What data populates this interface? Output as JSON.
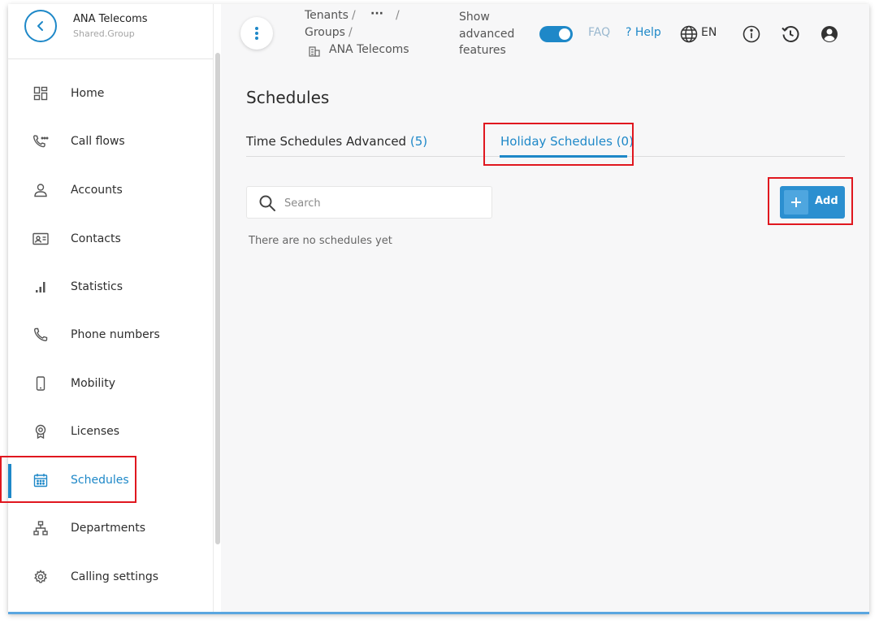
{
  "sidebar": {
    "org_name": "ANA Telecoms",
    "org_sub": "Shared.Group",
    "items": [
      {
        "label": "Home",
        "icon": "dashboard-icon"
      },
      {
        "label": "Call flows",
        "icon": "call-flow-icon"
      },
      {
        "label": "Accounts",
        "icon": "person-icon"
      },
      {
        "label": "Contacts",
        "icon": "contact-card-icon"
      },
      {
        "label": "Statistics",
        "icon": "bar-chart-icon"
      },
      {
        "label": "Phone numbers",
        "icon": "phone-icon"
      },
      {
        "label": "Mobility",
        "icon": "smartphone-icon"
      },
      {
        "label": "Licenses",
        "icon": "license-badge-icon"
      },
      {
        "label": "Schedules",
        "icon": "calendar-icon",
        "active": true
      },
      {
        "label": "Departments",
        "icon": "org-chart-icon"
      },
      {
        "label": "Calling settings",
        "icon": "gear-icon"
      }
    ]
  },
  "header": {
    "breadcrumb": {
      "tenants": "Tenants",
      "ellipsis": "···",
      "groups": "Groups",
      "current": "ANA Telecoms",
      "separator": "/"
    },
    "advanced_features": [
      "Show",
      "advanced",
      "features"
    ],
    "advanced_toggle_on": true,
    "faq": "FAQ",
    "help": "? Help",
    "language": "EN"
  },
  "main": {
    "title": "Schedules",
    "tabs": [
      {
        "label": "Time Schedules Advanced",
        "count": "(5)"
      },
      {
        "label": "Holiday Schedules",
        "count": "(0)",
        "active": true
      }
    ],
    "search": {
      "placeholder": "Search",
      "value": ""
    },
    "add_label": "Add",
    "empty_message": "There are no schedules yet"
  },
  "colors": {
    "accent": "#1e88c8",
    "highlight": "#e0171f"
  }
}
